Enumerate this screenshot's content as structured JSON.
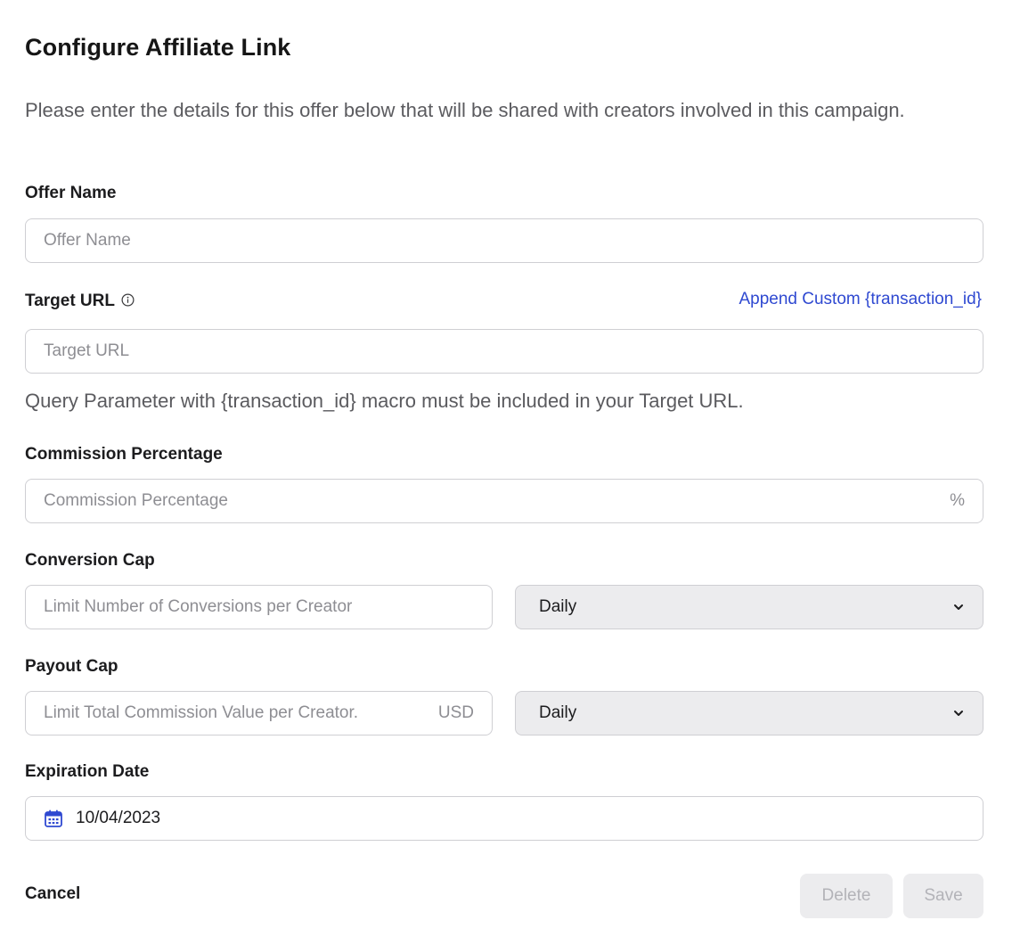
{
  "dialog": {
    "title": "Configure Affiliate Link",
    "description": "Please enter the details for this offer below that will be shared with creators involved in this campaign."
  },
  "offer_name": {
    "label": "Offer Name",
    "placeholder": "Offer Name",
    "value": ""
  },
  "target_url": {
    "label": "Target URL",
    "info_icon": "info-circle-icon",
    "append_link": "Append Custom {transaction_id}",
    "placeholder": "Target URL",
    "value": "",
    "hint": "Query Parameter with {transaction_id} macro must be included in your Target URL."
  },
  "commission": {
    "label": "Commission Percentage",
    "placeholder": "Commission Percentage",
    "value": "",
    "suffix": "%"
  },
  "conversion_cap": {
    "label": "Conversion Cap",
    "placeholder": "Limit Number of Conversions per Creator",
    "value": "",
    "period": "Daily",
    "chevron_icon": "chevron-down-icon"
  },
  "payout_cap": {
    "label": "Payout Cap",
    "placeholder": "Limit Total Commission Value per Creator.",
    "value": "",
    "currency": "USD",
    "period": "Daily",
    "chevron_icon": "chevron-down-icon"
  },
  "expiration": {
    "label": "Expiration Date",
    "value": "10/04/2023",
    "icon": "calendar-icon",
    "icon_color": "#2f49d1"
  },
  "actions": {
    "cancel": "Cancel",
    "delete": "Delete",
    "save": "Save"
  },
  "colors": {
    "accent": "#2f49d1",
    "disabled_bg": "#ececee",
    "disabled_text": "#b3b3b8"
  }
}
